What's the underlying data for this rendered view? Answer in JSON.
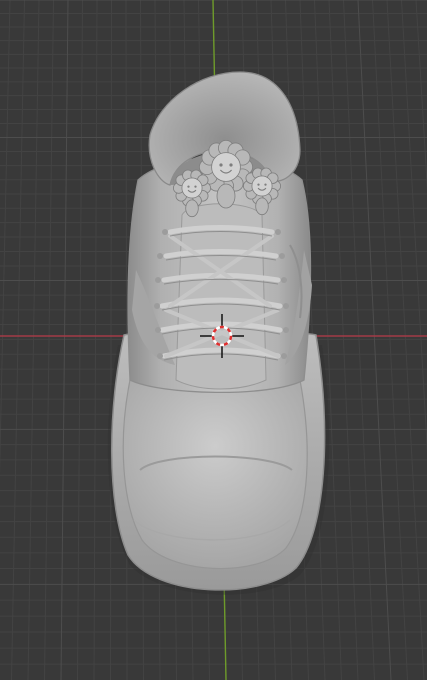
{
  "viewport": {
    "background_color": "#393939",
    "grid_minor_color": "#434343",
    "grid_major_color": "#4d4d4d",
    "x_axis_color": "#a33a47",
    "y_axis_color": "#6e9b2a"
  },
  "model": {
    "type": "sneaker-sculpt",
    "material_color": "#b8b8b8",
    "shadow_color": "#7e7e7e",
    "highlight_color": "#d2d2d2",
    "decoration": "flower-character-charms"
  },
  "cursor": {
    "icon": "3d-cursor-icon",
    "ring_color_a": "#e03030",
    "ring_color_b": "#ffffff"
  }
}
